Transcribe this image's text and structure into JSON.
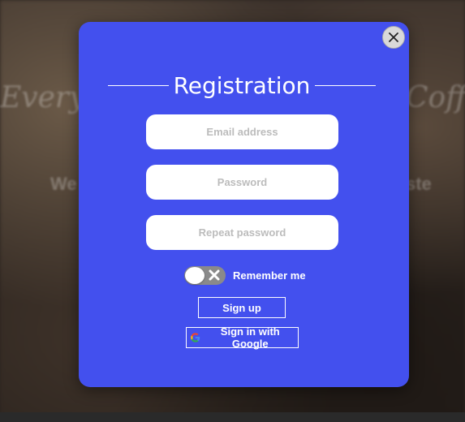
{
  "background": {
    "headline_left": "Every",
    "headline_right": "Coffe",
    "sub_left": "We",
    "sub_right": "ste"
  },
  "modal": {
    "title": "Registration",
    "close_icon": "close-icon",
    "email": {
      "placeholder": "Email address",
      "value": ""
    },
    "password": {
      "placeholder": "Password",
      "value": ""
    },
    "repeat_password": {
      "placeholder": "Repeat password",
      "value": ""
    },
    "remember": {
      "label": "Remember me",
      "checked": false
    },
    "signup_label": "Sign up",
    "google_label": "Sign in with Google",
    "google_icon": "google-icon"
  },
  "colors": {
    "modal_bg": "#4350ee",
    "toggle_off": "#8a8a8a",
    "text_on_accent": "#ffffff"
  }
}
